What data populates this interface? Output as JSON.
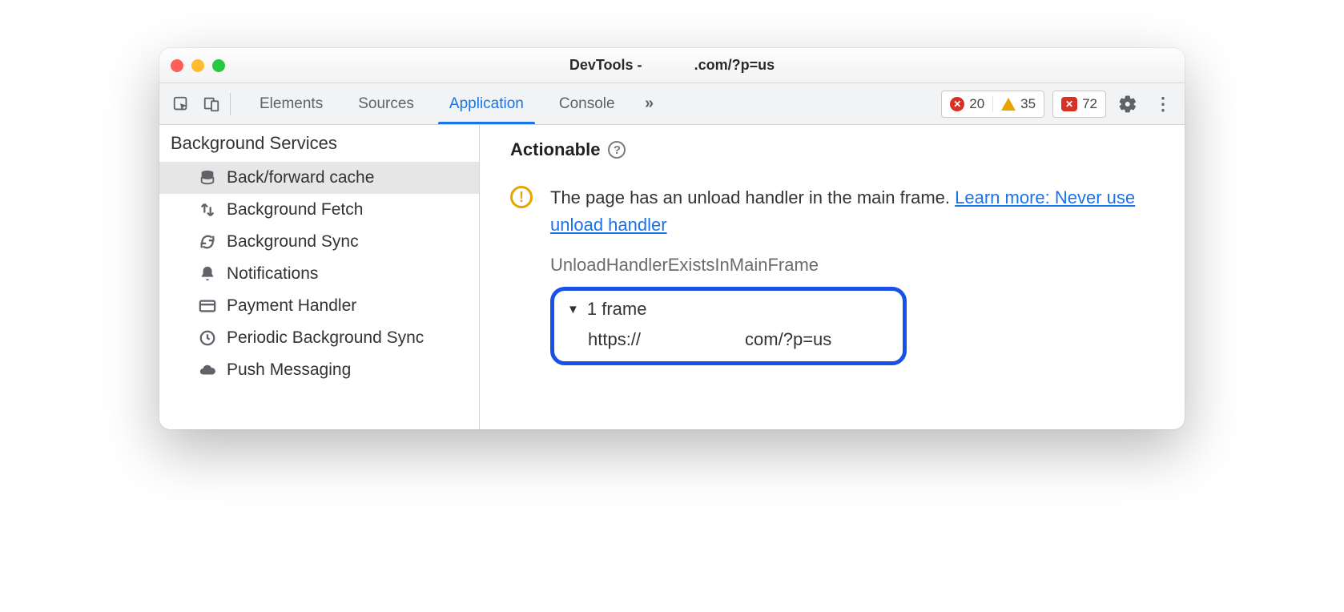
{
  "window": {
    "title_prefix": "DevTools -",
    "title_suffix": ".com/?p=us"
  },
  "tabs": {
    "items": [
      "Elements",
      "Sources",
      "Application",
      "Console"
    ],
    "active": "Application",
    "overflow": "»"
  },
  "badges": {
    "errors": "20",
    "warnings": "35",
    "issues": "72"
  },
  "sidebar": {
    "header": "Background Services",
    "items": [
      {
        "label": "Back/forward cache",
        "icon": "database",
        "selected": true
      },
      {
        "label": "Background Fetch",
        "icon": "updown",
        "selected": false
      },
      {
        "label": "Background Sync",
        "icon": "sync",
        "selected": false
      },
      {
        "label": "Notifications",
        "icon": "bell",
        "selected": false
      },
      {
        "label": "Payment Handler",
        "icon": "card",
        "selected": false
      },
      {
        "label": "Periodic Background Sync",
        "icon": "clock",
        "selected": false
      },
      {
        "label": "Push Messaging",
        "icon": "cloud",
        "selected": false
      }
    ]
  },
  "main": {
    "section_title": "Actionable",
    "issue_text": "The page has an unload handler in the main frame.",
    "issue_link": "Learn more: Never use unload handler",
    "issue_code": "UnloadHandlerExistsInMainFrame",
    "frame_count_label": "1 frame",
    "frame_url_scheme": "https://",
    "frame_url_rest": "com/?p=us"
  }
}
